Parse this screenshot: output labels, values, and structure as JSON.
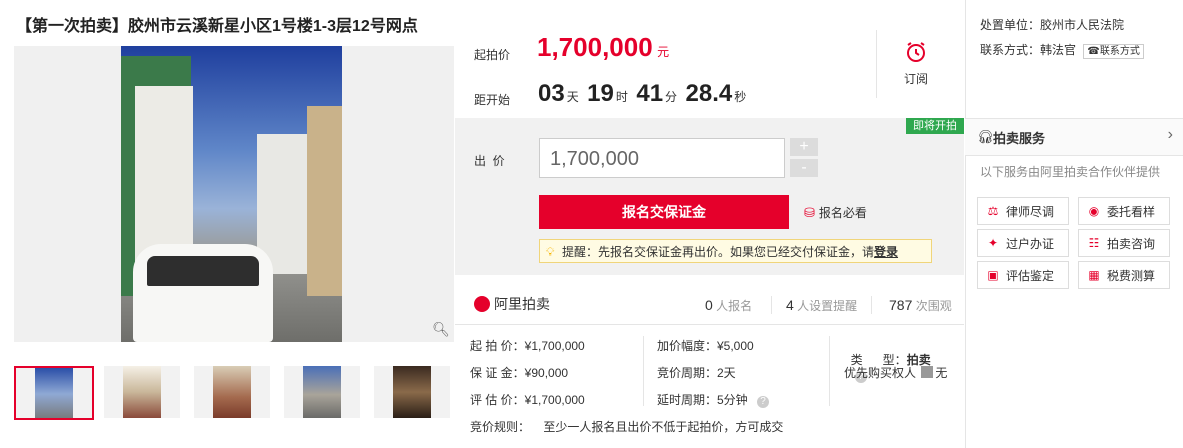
{
  "title": "【第一次拍卖】胶州市云溪新星小区1号楼1-3层12号网点",
  "gallery": {
    "zoom_icon": "magnifier-icon",
    "thumbnail_count": 5
  },
  "price": {
    "start_label": "起拍价",
    "start_value": "1,700,000",
    "start_unit": "元"
  },
  "countdown": {
    "label": "距开始",
    "days": "03",
    "days_unit": "天",
    "hours": "19",
    "hours_unit": "时",
    "minutes": "41",
    "minutes_unit": "分",
    "seconds": "28.4",
    "seconds_unit": "秒"
  },
  "subscribe": {
    "label": "订阅",
    "icon": "alarm-clock-icon"
  },
  "status_tag": "即将开拍",
  "bid": {
    "label": "出  价",
    "input_value": "1,700,000",
    "plus": "+",
    "minus": "-",
    "enroll_button": "报名交保证金",
    "must_see": "报名必看"
  },
  "tip": {
    "text": "提醒：先报名交保证金再出价。如果您已经交付保证金，请",
    "login": "登录"
  },
  "brand": {
    "name": "阿里拍卖"
  },
  "stats": {
    "enrolled_num": "0",
    "enrolled_label": "人报名",
    "reminders_num": "4",
    "reminders_label": "人设置提醒",
    "views_num": "787",
    "views_label": "次围观"
  },
  "details": {
    "start_price": "起 拍 价：¥1,700,000",
    "deposit": "保 证 金：¥90,000",
    "appraisal": "评 估 价：¥1,700,000",
    "increment": "加价幅度：¥5,000",
    "period": "竞价周期：2天",
    "delay": "延时周期：5分钟",
    "type_label": "类      型：",
    "type_value": "拍卖",
    "priority_label": "优先购买权人",
    "priority_value": "无",
    "rule_label": "竞价规则：",
    "rule_value": "至少一人报名且出价不低于起拍价，方可成交"
  },
  "court": {
    "unit_label": "处置单位：",
    "unit_value": "胶州市人民法院",
    "contact_label": "联系方式：",
    "contact_person": "韩法官",
    "contact_button": "联系方式"
  },
  "services": {
    "title": "拍卖服务",
    "desc": "以下服务由阿里拍卖合作伙伴提供",
    "items": [
      {
        "label": "律师尽调",
        "icon": "lawyer-icon"
      },
      {
        "label": "委托看样",
        "icon": "location-pin-icon"
      },
      {
        "label": "过户办证",
        "icon": "certificate-icon"
      },
      {
        "label": "拍卖咨询",
        "icon": "chat-icon"
      },
      {
        "label": "评估鉴定",
        "icon": "appraisal-icon"
      },
      {
        "label": "税费测算",
        "icon": "calculator-icon"
      }
    ]
  },
  "colors": {
    "accent": "#e5002b",
    "green_tag": "#2fa84f"
  }
}
